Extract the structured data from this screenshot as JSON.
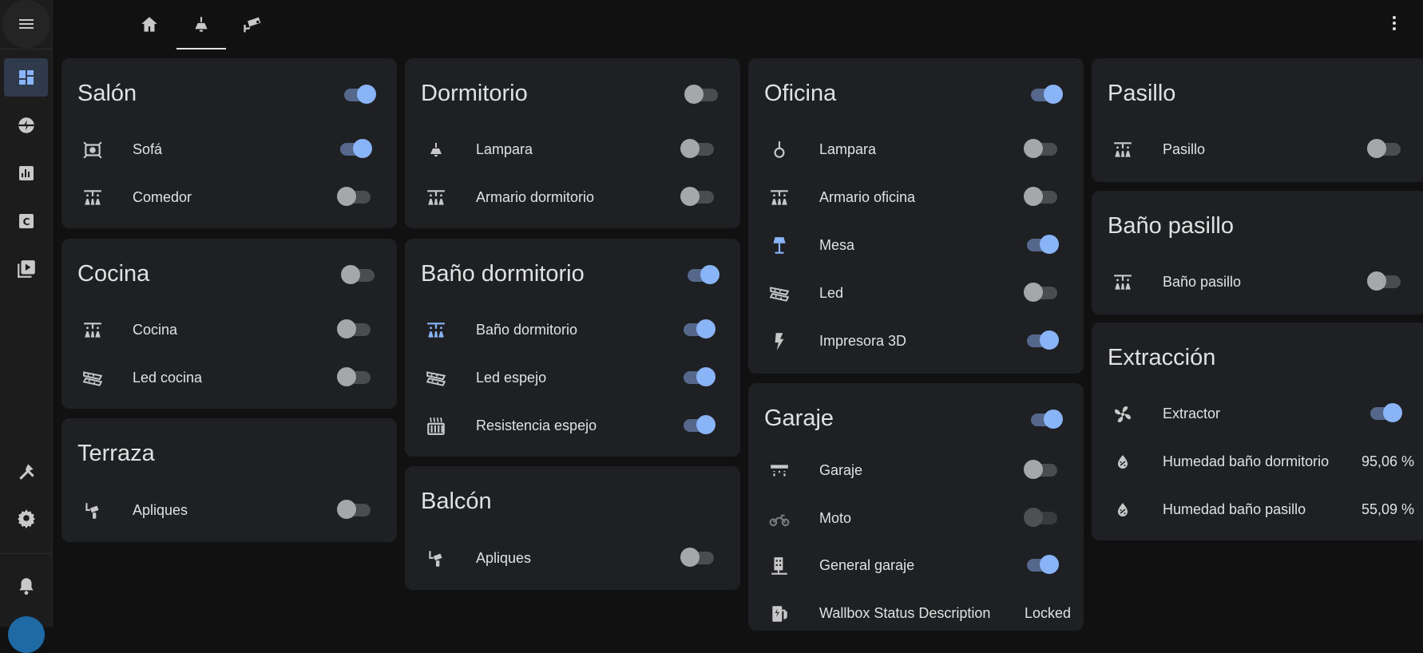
{
  "colors": {
    "accent": "#8ab4f8",
    "card": "#1f2023",
    "background": "#111111",
    "sidebar": "#1c1c1c"
  },
  "sidebar": {
    "menu_icon": "menu-icon",
    "items": [
      {
        "icon": "dashboard-icon",
        "active": true
      },
      {
        "icon": "energy-icon",
        "active": false
      },
      {
        "icon": "history-icon",
        "active": false
      },
      {
        "icon": "hacs-icon",
        "active": false
      },
      {
        "icon": "media-icon",
        "active": false
      }
    ],
    "bottom_items": [
      {
        "icon": "developer-tools-icon"
      },
      {
        "icon": "settings-icon"
      },
      {
        "icon": "notifications-icon"
      }
    ]
  },
  "topbar": {
    "tabs": [
      {
        "icon": "home-icon",
        "active": false
      },
      {
        "icon": "ceiling-light-icon",
        "active": true
      },
      {
        "icon": "security-camera-icon",
        "active": false
      }
    ],
    "menu_icon": "more-vertical-icon"
  },
  "cards": [
    {
      "title": "Salón",
      "toggle": true,
      "rows": [
        {
          "icon": "spotlight-icon",
          "label": "Sofá",
          "toggle": true
        },
        {
          "icon": "ceiling-lights-icon",
          "label": "Comedor",
          "toggle": false
        }
      ]
    },
    {
      "title": "Cocina",
      "toggle": false,
      "rows": [
        {
          "icon": "ceiling-lights-icon",
          "label": "Cocina",
          "toggle": false
        },
        {
          "icon": "led-strip-icon",
          "label": "Led cocina",
          "toggle": false
        }
      ]
    },
    {
      "title": "Terraza",
      "rows": [
        {
          "icon": "wall-sconce-icon",
          "label": "Apliques",
          "toggle": false
        }
      ]
    },
    {
      "title": "Dormitorio",
      "toggle": false,
      "rows": [
        {
          "icon": "ceiling-light-icon",
          "label": "Lampara",
          "toggle": false
        },
        {
          "icon": "ceiling-lights-icon",
          "label": "Armario dormitorio",
          "toggle": false
        }
      ]
    },
    {
      "title": "Baño dormitorio",
      "toggle": true,
      "rows": [
        {
          "icon": "ceiling-lights-icon",
          "label": "Baño dormitorio",
          "toggle": true
        },
        {
          "icon": "led-strip-icon",
          "label": "Led espejo",
          "toggle": true
        },
        {
          "icon": "radiator-icon",
          "label": "Resistencia espejo",
          "toggle": true
        }
      ]
    },
    {
      "title": "Balcón",
      "rows": [
        {
          "icon": "wall-sconce-icon",
          "label": "Apliques",
          "toggle": false
        }
      ]
    },
    {
      "title": "Oficina",
      "toggle": true,
      "rows": [
        {
          "icon": "pendant-light-icon",
          "label": "Lampara",
          "toggle": false
        },
        {
          "icon": "ceiling-lights-icon",
          "label": "Armario oficina",
          "toggle": false
        },
        {
          "icon": "desk-lamp-icon",
          "label": "Mesa",
          "toggle": true
        },
        {
          "icon": "led-strip-icon",
          "label": "Led",
          "toggle": false
        },
        {
          "icon": "flash-icon",
          "label": "Impresora 3D",
          "toggle": true
        }
      ]
    },
    {
      "title": "Garaje",
      "toggle": true,
      "rows": [
        {
          "icon": "garage-light-icon",
          "label": "Garaje",
          "toggle": false
        },
        {
          "icon": "motorbike-icon",
          "label": "Moto",
          "toggle": false,
          "disabled": true
        },
        {
          "icon": "electric-panel-icon",
          "label": "General garaje",
          "toggle": true
        },
        {
          "icon": "ev-station-icon",
          "label": "Wallbox Status Description",
          "value": "Locked"
        }
      ]
    },
    {
      "title": "Pasillo",
      "rows": [
        {
          "icon": "ceiling-lights-icon",
          "label": "Pasillo",
          "toggle": false
        }
      ]
    },
    {
      "title": "Baño pasillo",
      "rows": [
        {
          "icon": "ceiling-lights-icon",
          "label": "Baño pasillo",
          "toggle": false
        }
      ]
    },
    {
      "title": "Extracción",
      "rows": [
        {
          "icon": "fan-icon",
          "label": "Extractor",
          "toggle": true
        },
        {
          "icon": "water-percent-icon",
          "label": "Humedad baño dormitorio",
          "value": "95,06 %"
        },
        {
          "icon": "water-percent-icon",
          "label": "Humedad baño pasillo",
          "value": "55,09 %"
        }
      ]
    }
  ]
}
